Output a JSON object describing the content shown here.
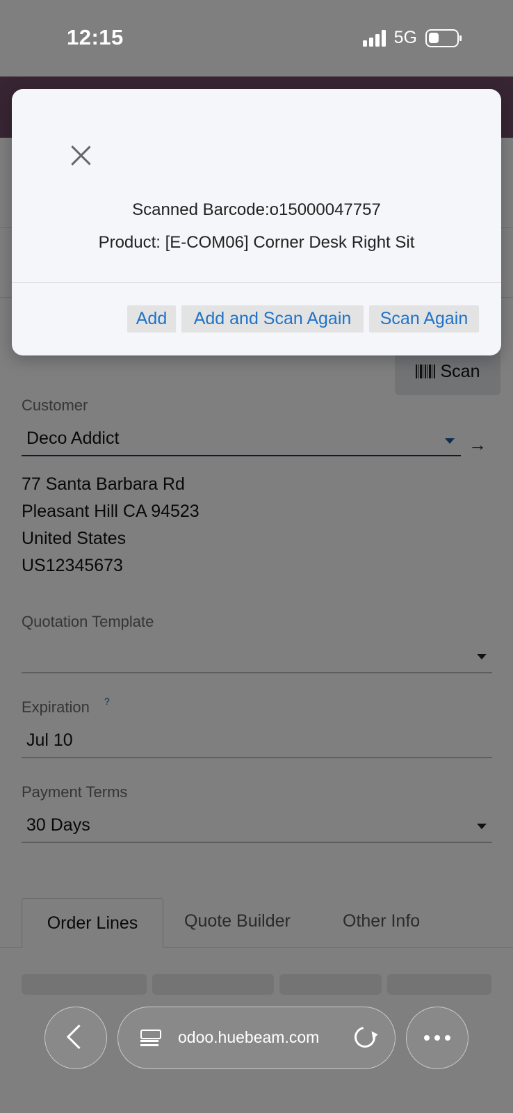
{
  "status": {
    "time": "12:15",
    "network": "5G"
  },
  "dialog": {
    "barcode_line": "Scanned Barcode:o15000047757",
    "product_line": "Product: [E-COM06] Corner Desk Right Sit",
    "buttons": {
      "add": "Add",
      "add_scan": "Add and Scan Again",
      "scan_again": "Scan Again"
    }
  },
  "form": {
    "scan_label": "Scan",
    "customer": {
      "label": "Customer",
      "value": "Deco Addict",
      "address": [
        "77 Santa Barbara Rd",
        "Pleasant Hill CA 94523",
        "United States",
        "US12345673"
      ]
    },
    "quotation_template": {
      "label": "Quotation Template",
      "value": ""
    },
    "expiration": {
      "label": "Expiration",
      "help": "?",
      "value": "Jul 10"
    },
    "payment_terms": {
      "label": "Payment Terms",
      "value": "30 Days"
    }
  },
  "tabs": [
    "Order Lines",
    "Quote Builder",
    "Other Info"
  ],
  "browser": {
    "url": "odoo.huebeam.com"
  },
  "colors": {
    "brand": "#714b67",
    "link": "#1f73c9"
  }
}
